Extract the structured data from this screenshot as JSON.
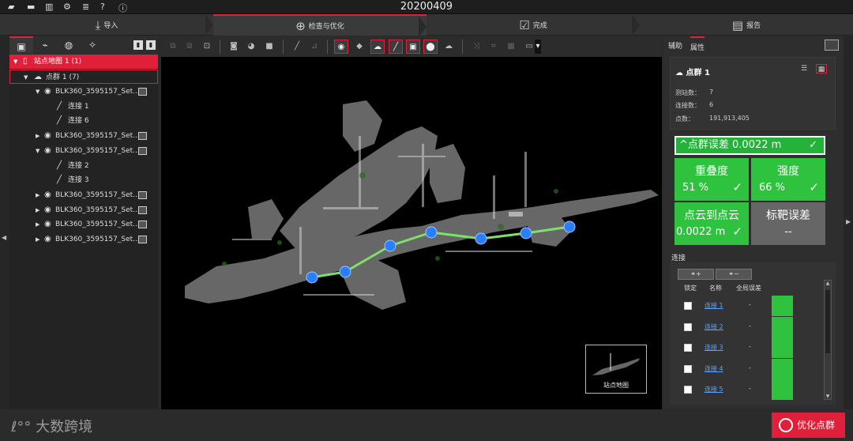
{
  "window": {
    "title": "20200409"
  },
  "topbar_icons": [
    "folder-open-icon",
    "folder-icon",
    "columns-icon",
    "gear-icon",
    "database-icon",
    "help-icon",
    "info-icon"
  ],
  "steps": [
    {
      "label": "导入",
      "icon": "import-icon",
      "active": false
    },
    {
      "label": "检查与优化",
      "icon": "inspect-icon",
      "active": true
    },
    {
      "label": "完成",
      "icon": "check-icon",
      "active": false
    },
    {
      "label": "报告",
      "icon": "report-icon",
      "active": false
    }
  ],
  "tree": {
    "root": "站点地图 1 (1)",
    "group": "点群 1 (7)",
    "items": [
      {
        "label": "BLK360_3595157_Set...",
        "expanded": true,
        "children": [
          "连接 1",
          "连接 6"
        ]
      },
      {
        "label": "BLK360_3595157_Set...",
        "expanded": false,
        "children": []
      },
      {
        "label": "BLK360_3595157_Set...",
        "expanded": true,
        "children": [
          "连接 2",
          "连接 3"
        ]
      },
      {
        "label": "BLK360_3595157_Set...",
        "expanded": false,
        "children": []
      },
      {
        "label": "BLK360_3595157_Set...",
        "expanded": false,
        "children": []
      },
      {
        "label": "BLK360_3595157_Set...",
        "expanded": false,
        "children": []
      },
      {
        "label": "BLK360_3595157_Set...",
        "expanded": false,
        "children": []
      }
    ]
  },
  "viewer": {
    "minimap_label": "站点地图"
  },
  "right": {
    "tabs": [
      "辅助",
      "属性"
    ],
    "active_tab": "属性",
    "card_title": "点群 1",
    "stats": [
      {
        "label": "测站数：",
        "value": "7"
      },
      {
        "label": "连接数：",
        "value": "6"
      },
      {
        "label": "点数：",
        "value": "191,913,405"
      }
    ],
    "error_banner": "^点群误差 0.0022 m",
    "tiles": [
      {
        "label": "重叠度",
        "value": "51 %",
        "ok": true
      },
      {
        "label": "强度",
        "value": "66 %",
        "ok": true
      },
      {
        "label": "点云到点云",
        "value": "0.0022 m",
        "ok": true
      },
      {
        "label": "标靶误差",
        "value": "--",
        "ok": false
      }
    ],
    "connections_label": "连接",
    "table_headers": [
      "锁定",
      "名称",
      "全局误差"
    ],
    "connections": [
      {
        "name": "连接 1",
        "error": "-"
      },
      {
        "name": "连接 2",
        "error": "-"
      },
      {
        "name": "连接 3",
        "error": "-"
      },
      {
        "name": "连接 4",
        "error": "-"
      },
      {
        "name": "连接 5",
        "error": "-"
      }
    ]
  },
  "bottom": {
    "watermark": "大数跨境",
    "optimize_button": "优化点群"
  },
  "colors": {
    "accent": "#e0203a",
    "ok_green": "#2ec23f",
    "node_blue": "#2a7fff",
    "link_green": "#7ee06b"
  }
}
